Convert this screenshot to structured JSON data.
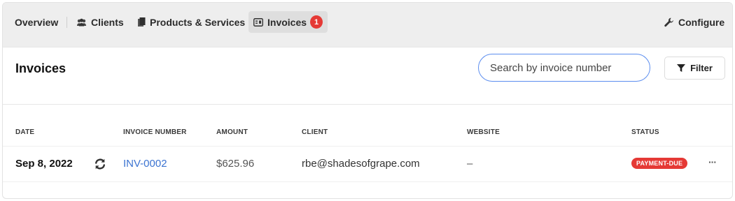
{
  "nav": {
    "overview": "Overview",
    "clients": "Clients",
    "products": "Products & Services",
    "invoices": "Invoices",
    "invoices_badge": "1",
    "configure": "Configure"
  },
  "header": {
    "title": "Invoices",
    "search_placeholder": "Search by invoice number",
    "filter_label": "Filter"
  },
  "table": {
    "columns": [
      "DATE",
      "INVOICE NUMBER",
      "AMOUNT",
      "CLIENT",
      "WEBSITE",
      "STATUS"
    ],
    "rows": [
      {
        "date": "Sep 8, 2022",
        "invoice_number": "INV-0002",
        "amount": "$625.96",
        "client": "rbe@shadesofgrape.com",
        "website": "–",
        "status": "PAYMENT-DUE",
        "more": "···"
      }
    ]
  },
  "colors": {
    "accent": "#5b8def",
    "link": "#3b73d1",
    "danger": "#e53935",
    "nav_bg": "#eeeeee"
  },
  "icons": [
    "clients-icon",
    "products-icon",
    "invoices-icon",
    "wrench-icon",
    "filter-icon",
    "recurring-icon",
    "more-icon"
  ]
}
